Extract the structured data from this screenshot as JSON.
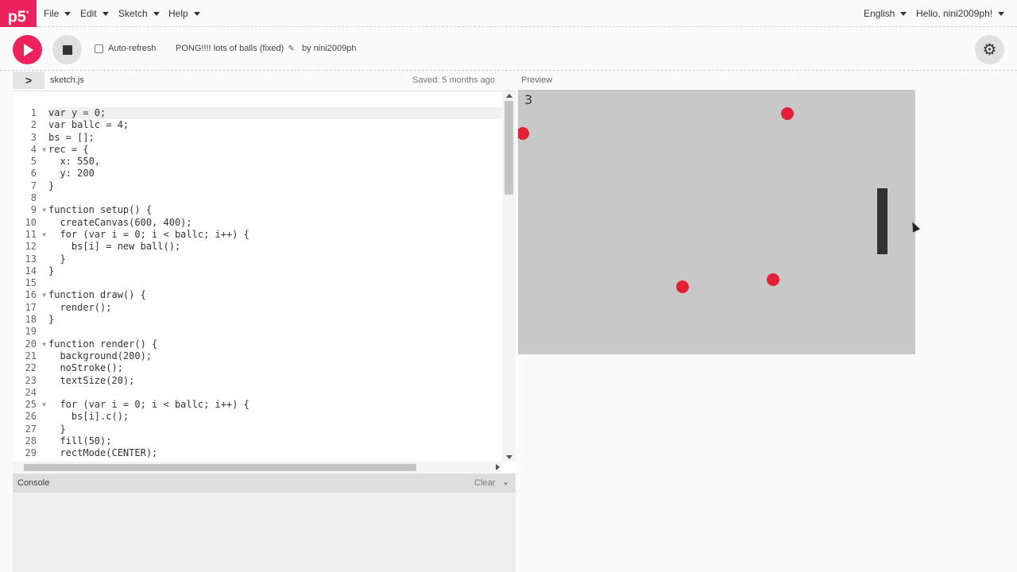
{
  "app": {
    "logo": "p5",
    "logo_mark": "*",
    "menus": [
      "File",
      "Edit",
      "Sketch",
      "Help"
    ],
    "language": "English",
    "user_greeting": "Hello, nini2009ph!"
  },
  "toolbar": {
    "autorefresh_label": "Auto-refresh",
    "sketch_name": "PONG!!!! lots of balls (fixed)",
    "byline": "by nini2009ph"
  },
  "editor": {
    "filename": "sketch.js",
    "saved": "Saved: 5 months ago",
    "lines": [
      "var y = 0;",
      "var ballc = 4;",
      "bs = [];",
      "rec = {",
      "  x: 550,",
      "  y: 200",
      "}",
      "",
      "function setup() {",
      "  createCanvas(600, 400);",
      "  for (var i = 0; i < ballc; i++) {",
      "    bs[i] = new ball();",
      "  }",
      "}",
      "",
      "function draw() {",
      "  render();",
      "}",
      "",
      "function render() {",
      "  background(200);",
      "  noStroke();",
      "  textSize(20);",
      "",
      "  for (var i = 0; i < ballc; i++) {",
      "    bs[i].c();",
      "  }",
      "  fill(50);",
      "  rectMode(CENTER);"
    ]
  },
  "preview": {
    "label": "Preview",
    "score": "3"
  },
  "console": {
    "title": "Console",
    "clear_label": "Clear"
  },
  "colors": {
    "accent": "#ed225d",
    "ball": "#e51f35",
    "canvas_bg": "#c8c8c8",
    "paddle": "#323232"
  }
}
